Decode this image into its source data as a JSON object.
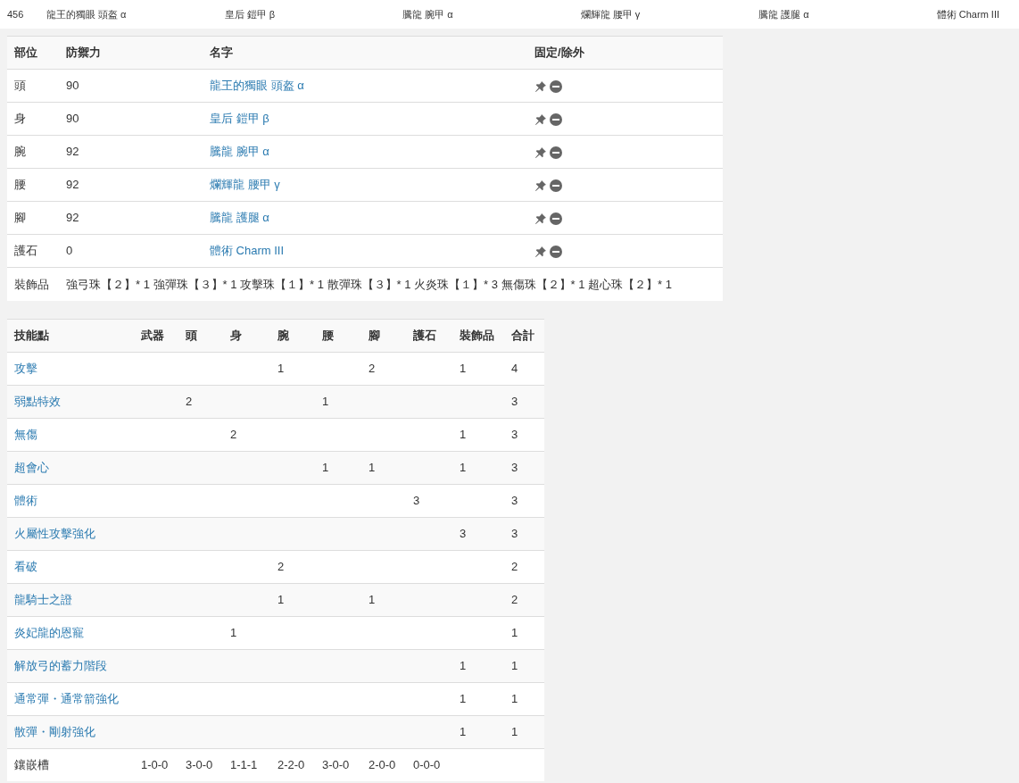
{
  "top_bar": [
    "456",
    "龍王的獨眼 頭盔 α",
    "皇后 鎧甲 β",
    "騰龍 腕甲 α",
    "爛輝龍 腰甲 γ",
    "騰龍 護腿 α",
    "體術 Charm III"
  ],
  "armor_table": {
    "columns": [
      "部位",
      "防禦力",
      "名字",
      "固定/除外"
    ],
    "rows": [
      {
        "part": "頭",
        "defense": "90",
        "name": "龍王的獨眼 頭盔 α"
      },
      {
        "part": "身",
        "defense": "90",
        "name": "皇后 鎧甲 β"
      },
      {
        "part": "腕",
        "defense": "92",
        "name": "騰龍 腕甲 α"
      },
      {
        "part": "腰",
        "defense": "92",
        "name": "爛輝龍 腰甲 γ"
      },
      {
        "part": "腳",
        "defense": "92",
        "name": "騰龍 護腿 α"
      },
      {
        "part": "護石",
        "defense": "0",
        "name": "體術 Charm III"
      }
    ],
    "decorations": {
      "label": "裝飾品",
      "text": "強弓珠【２】* 1 強彈珠【３】* 1 攻擊珠【１】* 1 散彈珠【３】* 1 火炎珠【１】* 3 無傷珠【２】* 1 超心珠【２】* 1"
    }
  },
  "skill_table": {
    "columns": [
      "技能點",
      "武器",
      "頭",
      "身",
      "腕",
      "腰",
      "腳",
      "護石",
      "裝飾品",
      "合計"
    ],
    "rows": [
      {
        "cells": [
          "攻擊",
          "",
          "",
          "",
          "1",
          "",
          "2",
          "",
          "1",
          "4"
        ]
      },
      {
        "cells": [
          "弱點特效",
          "",
          "2",
          "",
          "",
          "1",
          "",
          "",
          "",
          "3"
        ]
      },
      {
        "cells": [
          "無傷",
          "",
          "",
          "2",
          "",
          "",
          "",
          "",
          "1",
          "3"
        ]
      },
      {
        "cells": [
          "超會心",
          "",
          "",
          "",
          "",
          "1",
          "1",
          "",
          "1",
          "3"
        ]
      },
      {
        "cells": [
          "體術",
          "",
          "",
          "",
          "",
          "",
          "",
          "3",
          "",
          "3"
        ]
      },
      {
        "cells": [
          "火屬性攻擊強化",
          "",
          "",
          "",
          "",
          "",
          "",
          "",
          "3",
          "3"
        ]
      },
      {
        "cells": [
          "看破",
          "",
          "",
          "",
          "2",
          "",
          "",
          "",
          "",
          "2"
        ]
      },
      {
        "cells": [
          "龍騎士之證",
          "",
          "",
          "",
          "1",
          "",
          "1",
          "",
          "",
          "2"
        ]
      },
      {
        "cells": [
          "炎妃龍的恩寵",
          "",
          "",
          "1",
          "",
          "",
          "",
          "",
          "",
          "1"
        ]
      },
      {
        "cells": [
          "解放弓的蓄力階段",
          "",
          "",
          "",
          "",
          "",
          "",
          "",
          "1",
          "1"
        ]
      },
      {
        "cells": [
          "通常彈・通常箭強化",
          "",
          "",
          "",
          "",
          "",
          "",
          "",
          "1",
          "1"
        ]
      },
      {
        "cells": [
          "散彈・剛射強化",
          "",
          "",
          "",
          "",
          "",
          "",
          "",
          "1",
          "1"
        ]
      }
    ],
    "slots": {
      "cells": [
        "鑲嵌槽",
        "1-0-0",
        "3-0-0",
        "1-1-1",
        "2-2-0",
        "3-0-0",
        "2-0-0",
        "0-0-0",
        "",
        ""
      ]
    }
  }
}
